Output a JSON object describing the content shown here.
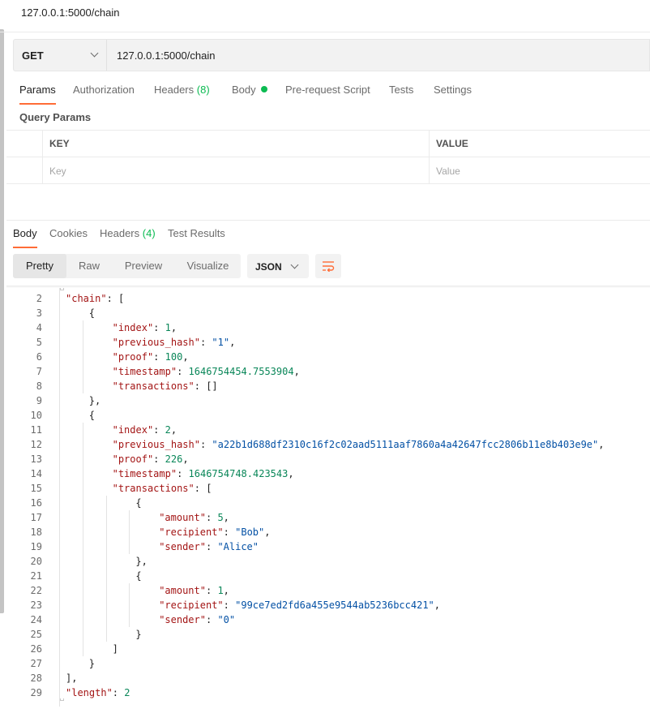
{
  "title_bar": {
    "title": "127.0.0.1:5000/chain"
  },
  "request": {
    "method": "GET",
    "url": "127.0.0.1:5000/chain"
  },
  "request_tabs": [
    {
      "label": "Params"
    },
    {
      "label": "Authorization"
    },
    {
      "label": "Headers",
      "count": "(8)"
    },
    {
      "label": "Body"
    },
    {
      "label": "Pre-request Script"
    },
    {
      "label": "Tests"
    },
    {
      "label": "Settings"
    }
  ],
  "query_params": {
    "title": "Query Params",
    "key_header": "KEY",
    "value_header": "VALUE",
    "key_placeholder": "Key",
    "value_placeholder": "Value"
  },
  "response_tabs": [
    {
      "label": "Body"
    },
    {
      "label": "Cookies"
    },
    {
      "label": "Headers",
      "count": "(4)"
    },
    {
      "label": "Test Results"
    }
  ],
  "view_modes": [
    "Pretty",
    "Raw",
    "Preview",
    "Visualize"
  ],
  "format": "JSON",
  "colors": {
    "accent_orange": "#ff6c37",
    "success_green": "#0cbb52",
    "json_key": "#a31515",
    "json_string": "#0451a5",
    "json_number": "#098658"
  },
  "icons": {
    "method_dropdown": "chevron-down-icon",
    "format_dropdown": "chevron-down-icon",
    "wrap": "wrap-lines-icon"
  },
  "code_lines": [
    {
      "ln": "2",
      "indent": 1,
      "tokens": [
        [
          "k",
          "\"chain\""
        ],
        [
          "p",
          ": ["
        ]
      ]
    },
    {
      "ln": "3",
      "indent": 2,
      "tokens": [
        [
          "p",
          "{"
        ]
      ]
    },
    {
      "ln": "4",
      "indent": 3,
      "tokens": [
        [
          "k",
          "\"index\""
        ],
        [
          "p",
          ": "
        ],
        [
          "n",
          "1"
        ],
        [
          "p",
          ","
        ]
      ]
    },
    {
      "ln": "5",
      "indent": 3,
      "tokens": [
        [
          "k",
          "\"previous_hash\""
        ],
        [
          "p",
          ": "
        ],
        [
          "s",
          "\"1\""
        ],
        [
          "p",
          ","
        ]
      ]
    },
    {
      "ln": "6",
      "indent": 3,
      "tokens": [
        [
          "k",
          "\"proof\""
        ],
        [
          "p",
          ": "
        ],
        [
          "n",
          "100"
        ],
        [
          "p",
          ","
        ]
      ]
    },
    {
      "ln": "7",
      "indent": 3,
      "tokens": [
        [
          "k",
          "\"timestamp\""
        ],
        [
          "p",
          ": "
        ],
        [
          "n",
          "1646754454.7553904"
        ],
        [
          "p",
          ","
        ]
      ]
    },
    {
      "ln": "8",
      "indent": 3,
      "tokens": [
        [
          "k",
          "\"transactions\""
        ],
        [
          "p",
          ": []"
        ]
      ]
    },
    {
      "ln": "9",
      "indent": 2,
      "tokens": [
        [
          "p",
          "},"
        ]
      ]
    },
    {
      "ln": "10",
      "indent": 2,
      "tokens": [
        [
          "p",
          "{"
        ]
      ]
    },
    {
      "ln": "11",
      "indent": 3,
      "tokens": [
        [
          "k",
          "\"index\""
        ],
        [
          "p",
          ": "
        ],
        [
          "n",
          "2"
        ],
        [
          "p",
          ","
        ]
      ]
    },
    {
      "ln": "12",
      "indent": 3,
      "tokens": [
        [
          "k",
          "\"previous_hash\""
        ],
        [
          "p",
          ": "
        ],
        [
          "s",
          "\"a22b1d688df2310c16f2c02aad5111aaf7860a4a42647fcc2806b11e8b403e9e\""
        ],
        [
          "p",
          ","
        ]
      ]
    },
    {
      "ln": "13",
      "indent": 3,
      "tokens": [
        [
          "k",
          "\"proof\""
        ],
        [
          "p",
          ": "
        ],
        [
          "n",
          "226"
        ],
        [
          "p",
          ","
        ]
      ]
    },
    {
      "ln": "14",
      "indent": 3,
      "tokens": [
        [
          "k",
          "\"timestamp\""
        ],
        [
          "p",
          ": "
        ],
        [
          "n",
          "1646754748.423543"
        ],
        [
          "p",
          ","
        ]
      ]
    },
    {
      "ln": "15",
      "indent": 3,
      "tokens": [
        [
          "k",
          "\"transactions\""
        ],
        [
          "p",
          ": ["
        ]
      ]
    },
    {
      "ln": "16",
      "indent": 4,
      "tokens": [
        [
          "p",
          "{"
        ]
      ]
    },
    {
      "ln": "17",
      "indent": 5,
      "tokens": [
        [
          "k",
          "\"amount\""
        ],
        [
          "p",
          ": "
        ],
        [
          "n",
          "5"
        ],
        [
          "p",
          ","
        ]
      ]
    },
    {
      "ln": "18",
      "indent": 5,
      "tokens": [
        [
          "k",
          "\"recipient\""
        ],
        [
          "p",
          ": "
        ],
        [
          "s",
          "\"Bob\""
        ],
        [
          "p",
          ","
        ]
      ]
    },
    {
      "ln": "19",
      "indent": 5,
      "tokens": [
        [
          "k",
          "\"sender\""
        ],
        [
          "p",
          ": "
        ],
        [
          "s",
          "\"Alice\""
        ]
      ]
    },
    {
      "ln": "20",
      "indent": 4,
      "tokens": [
        [
          "p",
          "},"
        ]
      ]
    },
    {
      "ln": "21",
      "indent": 4,
      "tokens": [
        [
          "p",
          "{"
        ]
      ]
    },
    {
      "ln": "22",
      "indent": 5,
      "tokens": [
        [
          "k",
          "\"amount\""
        ],
        [
          "p",
          ": "
        ],
        [
          "n",
          "1"
        ],
        [
          "p",
          ","
        ]
      ]
    },
    {
      "ln": "23",
      "indent": 5,
      "tokens": [
        [
          "k",
          "\"recipient\""
        ],
        [
          "p",
          ": "
        ],
        [
          "s",
          "\"99ce7ed2fd6a455e9544ab5236bcc421\""
        ],
        [
          "p",
          ","
        ]
      ]
    },
    {
      "ln": "24",
      "indent": 5,
      "tokens": [
        [
          "k",
          "\"sender\""
        ],
        [
          "p",
          ": "
        ],
        [
          "s",
          "\"0\""
        ]
      ]
    },
    {
      "ln": "25",
      "indent": 4,
      "tokens": [
        [
          "p",
          "}"
        ]
      ]
    },
    {
      "ln": "26",
      "indent": 3,
      "tokens": [
        [
          "p",
          "]"
        ]
      ]
    },
    {
      "ln": "27",
      "indent": 2,
      "tokens": [
        [
          "p",
          "}"
        ]
      ]
    },
    {
      "ln": "28",
      "indent": 1,
      "tokens": [
        [
          "p",
          "],"
        ]
      ]
    },
    {
      "ln": "29",
      "indent": 1,
      "tokens": [
        [
          "k",
          "\"length\""
        ],
        [
          "p",
          ": "
        ],
        [
          "n",
          "2"
        ]
      ]
    }
  ]
}
